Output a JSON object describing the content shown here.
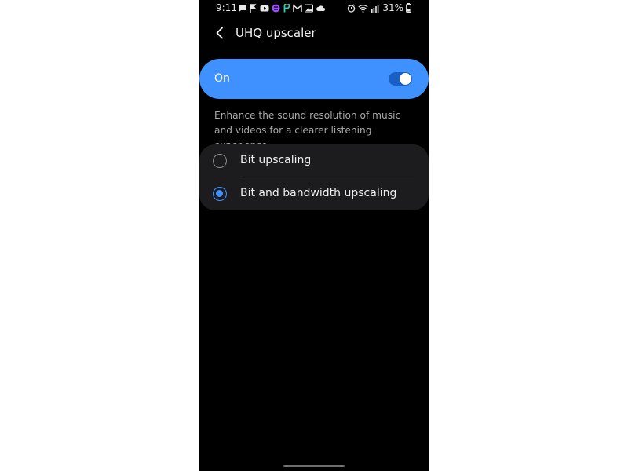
{
  "status_bar": {
    "time": "9:11",
    "battery": "31%",
    "left_icons": [
      "message-icon",
      "flag-icon",
      "youtube-icon",
      "app-icon-purple",
      "app-icon-teal",
      "gmail-icon",
      "gallery-icon",
      "cloud-icon"
    ],
    "right_icons": [
      "alarm-icon",
      "wifi-icon",
      "signal-icon",
      "battery-icon"
    ]
  },
  "header": {
    "title": "UHQ upscaler",
    "back_icon": "back-chevron-icon"
  },
  "master_switch": {
    "label": "On",
    "enabled": true
  },
  "description": "Enhance the sound resolution of music and videos for a clearer listening experience.",
  "options": [
    {
      "label": "Bit upscaling",
      "selected": false
    },
    {
      "label": "Bit and bandwidth upscaling",
      "selected": true
    }
  ],
  "colors": {
    "accent": "#3e91ff",
    "background": "#000000",
    "card": "#1c1c1e"
  }
}
